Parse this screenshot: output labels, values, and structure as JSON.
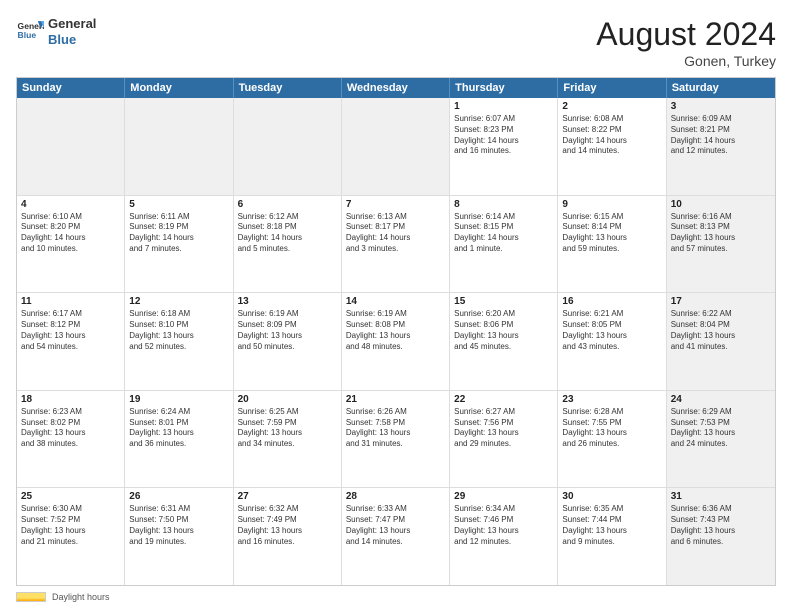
{
  "header": {
    "logo_general": "General",
    "logo_blue": "Blue",
    "month_title": "August 2024",
    "subtitle": "Gonen, Turkey"
  },
  "days_of_week": [
    "Sunday",
    "Monday",
    "Tuesday",
    "Wednesday",
    "Thursday",
    "Friday",
    "Saturday"
  ],
  "footer": {
    "daylight_label": "Daylight hours"
  },
  "weeks": [
    {
      "cells": [
        {
          "day": "",
          "info": "",
          "shaded": true
        },
        {
          "day": "",
          "info": "",
          "shaded": true
        },
        {
          "day": "",
          "info": "",
          "shaded": true
        },
        {
          "day": "",
          "info": "",
          "shaded": true
        },
        {
          "day": "1",
          "info": "Sunrise: 6:07 AM\nSunset: 8:23 PM\nDaylight: 14 hours\nand 16 minutes."
        },
        {
          "day": "2",
          "info": "Sunrise: 6:08 AM\nSunset: 8:22 PM\nDaylight: 14 hours\nand 14 minutes."
        },
        {
          "day": "3",
          "info": "Sunrise: 6:09 AM\nSunset: 8:21 PM\nDaylight: 14 hours\nand 12 minutes.",
          "shaded": true
        }
      ]
    },
    {
      "cells": [
        {
          "day": "4",
          "info": "Sunrise: 6:10 AM\nSunset: 8:20 PM\nDaylight: 14 hours\nand 10 minutes."
        },
        {
          "day": "5",
          "info": "Sunrise: 6:11 AM\nSunset: 8:19 PM\nDaylight: 14 hours\nand 7 minutes."
        },
        {
          "day": "6",
          "info": "Sunrise: 6:12 AM\nSunset: 8:18 PM\nDaylight: 14 hours\nand 5 minutes."
        },
        {
          "day": "7",
          "info": "Sunrise: 6:13 AM\nSunset: 8:17 PM\nDaylight: 14 hours\nand 3 minutes."
        },
        {
          "day": "8",
          "info": "Sunrise: 6:14 AM\nSunset: 8:15 PM\nDaylight: 14 hours\nand 1 minute."
        },
        {
          "day": "9",
          "info": "Sunrise: 6:15 AM\nSunset: 8:14 PM\nDaylight: 13 hours\nand 59 minutes."
        },
        {
          "day": "10",
          "info": "Sunrise: 6:16 AM\nSunset: 8:13 PM\nDaylight: 13 hours\nand 57 minutes.",
          "shaded": true
        }
      ]
    },
    {
      "cells": [
        {
          "day": "11",
          "info": "Sunrise: 6:17 AM\nSunset: 8:12 PM\nDaylight: 13 hours\nand 54 minutes."
        },
        {
          "day": "12",
          "info": "Sunrise: 6:18 AM\nSunset: 8:10 PM\nDaylight: 13 hours\nand 52 minutes."
        },
        {
          "day": "13",
          "info": "Sunrise: 6:19 AM\nSunset: 8:09 PM\nDaylight: 13 hours\nand 50 minutes."
        },
        {
          "day": "14",
          "info": "Sunrise: 6:19 AM\nSunset: 8:08 PM\nDaylight: 13 hours\nand 48 minutes."
        },
        {
          "day": "15",
          "info": "Sunrise: 6:20 AM\nSunset: 8:06 PM\nDaylight: 13 hours\nand 45 minutes."
        },
        {
          "day": "16",
          "info": "Sunrise: 6:21 AM\nSunset: 8:05 PM\nDaylight: 13 hours\nand 43 minutes."
        },
        {
          "day": "17",
          "info": "Sunrise: 6:22 AM\nSunset: 8:04 PM\nDaylight: 13 hours\nand 41 minutes.",
          "shaded": true
        }
      ]
    },
    {
      "cells": [
        {
          "day": "18",
          "info": "Sunrise: 6:23 AM\nSunset: 8:02 PM\nDaylight: 13 hours\nand 38 minutes."
        },
        {
          "day": "19",
          "info": "Sunrise: 6:24 AM\nSunset: 8:01 PM\nDaylight: 13 hours\nand 36 minutes."
        },
        {
          "day": "20",
          "info": "Sunrise: 6:25 AM\nSunset: 7:59 PM\nDaylight: 13 hours\nand 34 minutes."
        },
        {
          "day": "21",
          "info": "Sunrise: 6:26 AM\nSunset: 7:58 PM\nDaylight: 13 hours\nand 31 minutes."
        },
        {
          "day": "22",
          "info": "Sunrise: 6:27 AM\nSunset: 7:56 PM\nDaylight: 13 hours\nand 29 minutes."
        },
        {
          "day": "23",
          "info": "Sunrise: 6:28 AM\nSunset: 7:55 PM\nDaylight: 13 hours\nand 26 minutes."
        },
        {
          "day": "24",
          "info": "Sunrise: 6:29 AM\nSunset: 7:53 PM\nDaylight: 13 hours\nand 24 minutes.",
          "shaded": true
        }
      ]
    },
    {
      "cells": [
        {
          "day": "25",
          "info": "Sunrise: 6:30 AM\nSunset: 7:52 PM\nDaylight: 13 hours\nand 21 minutes."
        },
        {
          "day": "26",
          "info": "Sunrise: 6:31 AM\nSunset: 7:50 PM\nDaylight: 13 hours\nand 19 minutes."
        },
        {
          "day": "27",
          "info": "Sunrise: 6:32 AM\nSunset: 7:49 PM\nDaylight: 13 hours\nand 16 minutes."
        },
        {
          "day": "28",
          "info": "Sunrise: 6:33 AM\nSunset: 7:47 PM\nDaylight: 13 hours\nand 14 minutes."
        },
        {
          "day": "29",
          "info": "Sunrise: 6:34 AM\nSunset: 7:46 PM\nDaylight: 13 hours\nand 12 minutes."
        },
        {
          "day": "30",
          "info": "Sunrise: 6:35 AM\nSunset: 7:44 PM\nDaylight: 13 hours\nand 9 minutes."
        },
        {
          "day": "31",
          "info": "Sunrise: 6:36 AM\nSunset: 7:43 PM\nDaylight: 13 hours\nand 6 minutes.",
          "shaded": true
        }
      ]
    }
  ]
}
